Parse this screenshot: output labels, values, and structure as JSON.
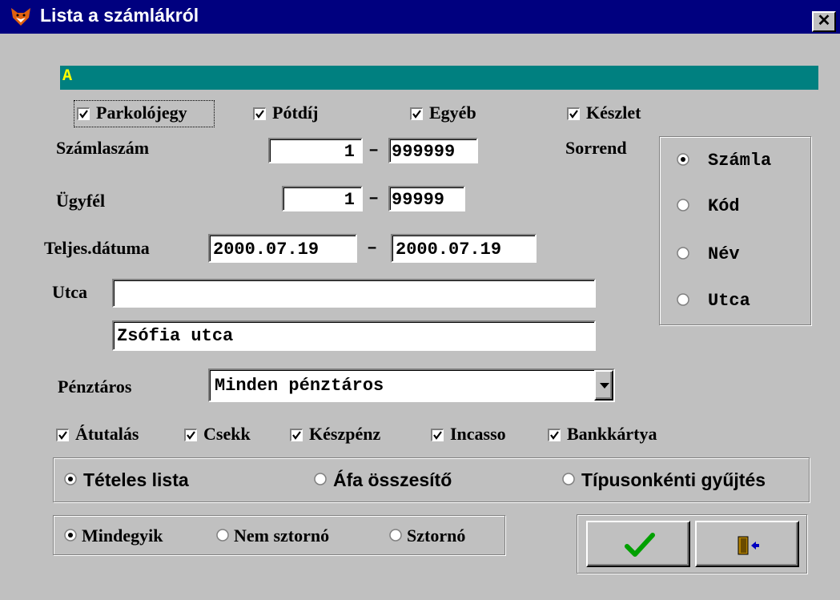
{
  "window": {
    "title": "Lista a számlákról",
    "close_glyph": "✕"
  },
  "status_text": "A",
  "types": [
    {
      "label": "Parkolójegy",
      "checked": true
    },
    {
      "label": "Pótdíj",
      "checked": true
    },
    {
      "label": "Egyéb",
      "checked": true
    },
    {
      "label": "Készlet",
      "checked": true
    }
  ],
  "szamlaszam": {
    "label": "Számlaszám",
    "from": "1",
    "dash": "–",
    "to": "999999"
  },
  "ugyfel": {
    "label": "Ügyfél",
    "from": "1",
    "dash": "–",
    "to": "99999"
  },
  "teljes": {
    "label": "Teljes.dátuma",
    "from": "2000.07.19",
    "dash": "–",
    "to": "2000.07.19"
  },
  "utca": {
    "label": "Utca",
    "value1": "",
    "value2": "Zsófia utca"
  },
  "sorrend": {
    "label": "Sorrend",
    "options": [
      "Számla",
      "Kód",
      "Név",
      "Utca"
    ],
    "selected": "Számla"
  },
  "penztaros": {
    "label": "Pénztáros",
    "value": "Minden pénztáros"
  },
  "payments": [
    {
      "label": "Átutalás",
      "checked": true
    },
    {
      "label": "Csekk",
      "checked": true
    },
    {
      "label": "Készpénz",
      "checked": true
    },
    {
      "label": "Incasso",
      "checked": true
    },
    {
      "label": "Bankkártya",
      "checked": true
    }
  ],
  "list_type": {
    "options": [
      "Tételes lista",
      "Áfa összesítő",
      "Típusonkénti gyűjtés"
    ],
    "selected": "Tételes lista"
  },
  "storno": {
    "options": [
      "Mindegyik",
      "Nem sztornó",
      "Sztornó"
    ],
    "selected": "Mindegyik"
  },
  "buttons": {
    "ok_icon": "checkmark-icon",
    "exit_icon": "exit-door-icon"
  },
  "colors": {
    "titlebar": "#00007f",
    "status_bar": "#008080",
    "status_text": "#ffff00",
    "ok_check": "#00a000"
  }
}
